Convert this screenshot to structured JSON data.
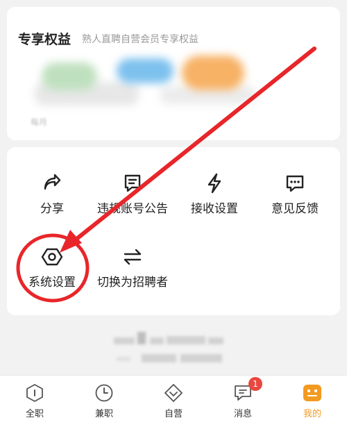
{
  "benefits": {
    "title": "专享权益",
    "subtitle": "熟人直聘自营会员专享权益",
    "monthly_text": "每月"
  },
  "tools": [
    {
      "label": "分享",
      "icon": "share-icon"
    },
    {
      "label": "违规账号公告",
      "icon": "notice-icon"
    },
    {
      "label": "接收设置",
      "icon": "lightning-icon"
    },
    {
      "label": "意见反馈",
      "icon": "feedback-icon"
    },
    {
      "label": "系统设置",
      "icon": "gear-icon"
    },
    {
      "label": "切换为招聘者",
      "icon": "swap-icon"
    }
  ],
  "tabbar": {
    "tabs": [
      {
        "label": "全职",
        "icon": "info-icon"
      },
      {
        "label": "兼职",
        "icon": "clock-icon"
      },
      {
        "label": "自营",
        "icon": "diamond-icon"
      },
      {
        "label": "消息",
        "icon": "message-icon",
        "badge": "1"
      },
      {
        "label": "我的",
        "icon": "profile-icon",
        "active": true
      }
    ]
  },
  "colors": {
    "accent": "#f39a21",
    "badge": "#e8483f",
    "annotation": "#e8262a"
  }
}
